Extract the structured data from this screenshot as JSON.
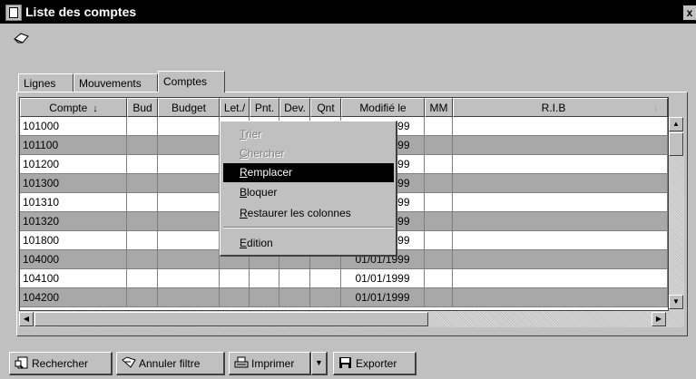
{
  "window": {
    "title": "Liste des comptes",
    "close_label": "x"
  },
  "tabs": [
    {
      "label": "Lignes"
    },
    {
      "label": "Mouvements"
    },
    {
      "label": "Comptes"
    }
  ],
  "grid": {
    "columns": [
      {
        "label": "Compte",
        "sortable": true
      },
      {
        "label": "Bud"
      },
      {
        "label": "Budget"
      },
      {
        "label": "Let./"
      },
      {
        "label": "Pnt."
      },
      {
        "label": "Dev."
      },
      {
        "label": "Qnt"
      },
      {
        "label": "Modifié le"
      },
      {
        "label": "MM"
      },
      {
        "label": "R.I.B"
      }
    ],
    "rows": [
      {
        "compte": "101000",
        "modifie": "01/01/1999"
      },
      {
        "compte": "101100",
        "modifie": "01/01/1999"
      },
      {
        "compte": "101200",
        "modifie": "01/01/1999"
      },
      {
        "compte": "101300",
        "modifie": "01/01/1999"
      },
      {
        "compte": "101310",
        "modifie": "01/01/1999"
      },
      {
        "compte": "101320",
        "modifie": "01/01/1999"
      },
      {
        "compte": "101800",
        "modifie": "01/01/1999"
      },
      {
        "compte": "104000",
        "modifie": "01/01/1999"
      },
      {
        "compte": "104100",
        "modifie": "01/01/1999"
      },
      {
        "compte": "104200",
        "modifie": "01/01/1999"
      }
    ]
  },
  "context_menu": {
    "items": [
      {
        "first": "T",
        "rest": "rier",
        "state": "disabled"
      },
      {
        "first": "C",
        "rest": "hercher",
        "state": "disabled"
      },
      {
        "first": "R",
        "rest": "emplacer",
        "state": "selected"
      },
      {
        "first": "B",
        "rest": "loquer",
        "state": "normal"
      },
      {
        "first": "R",
        "rest": "estaurer les colonnes",
        "state": "normal"
      },
      {
        "first": "E",
        "rest": "dition",
        "state": "normal"
      }
    ]
  },
  "toolbar": {
    "search_label": "Rechercher",
    "clear_filter_label": "Annuler filtre",
    "print_label": "Imprimer",
    "export_label": "Exporter"
  }
}
